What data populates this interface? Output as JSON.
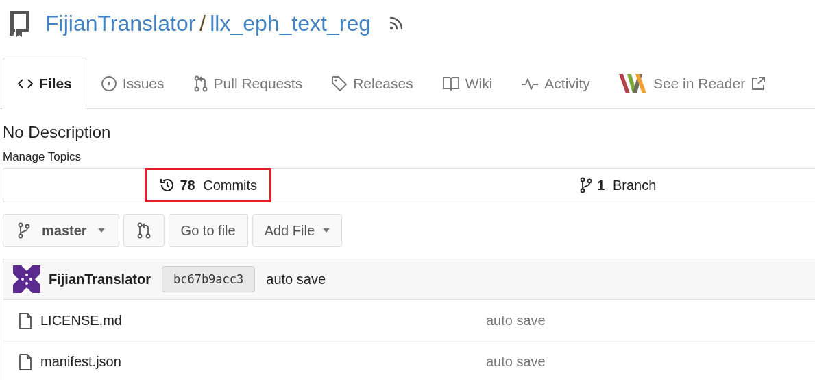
{
  "header": {
    "owner": "FijianTranslator",
    "separator": "/",
    "repo": "llx_eph_text_reg"
  },
  "tabs": [
    {
      "kind": "files",
      "label": "Files",
      "selected": true
    },
    {
      "kind": "issues",
      "label": "Issues",
      "selected": false
    },
    {
      "kind": "pulls",
      "label": "Pull Requests",
      "selected": false
    },
    {
      "kind": "releases",
      "label": "Releases",
      "selected": false
    },
    {
      "kind": "wiki",
      "label": "Wiki",
      "selected": false
    },
    {
      "kind": "activity",
      "label": "Activity",
      "selected": false
    },
    {
      "kind": "reader",
      "label": "See in Reader",
      "selected": false
    }
  ],
  "description": "No Description",
  "manage_topics": "Manage Topics",
  "stats": [
    {
      "kind": "commits",
      "count": "78",
      "label": "Commits",
      "highlighted": true
    },
    {
      "kind": "branches",
      "count": "1",
      "label": "Branch",
      "highlighted": false
    }
  ],
  "toolbar": {
    "branch": "master",
    "go_to_file": "Go to file",
    "add_file": "Add File"
  },
  "latest_commit": {
    "author": "FijianTranslator",
    "sha": "bc67b9acc3",
    "message": "auto save"
  },
  "files": [
    {
      "name": "LICENSE.md",
      "message": "auto save"
    },
    {
      "name": "manifest.json",
      "message": "auto save"
    }
  ]
}
